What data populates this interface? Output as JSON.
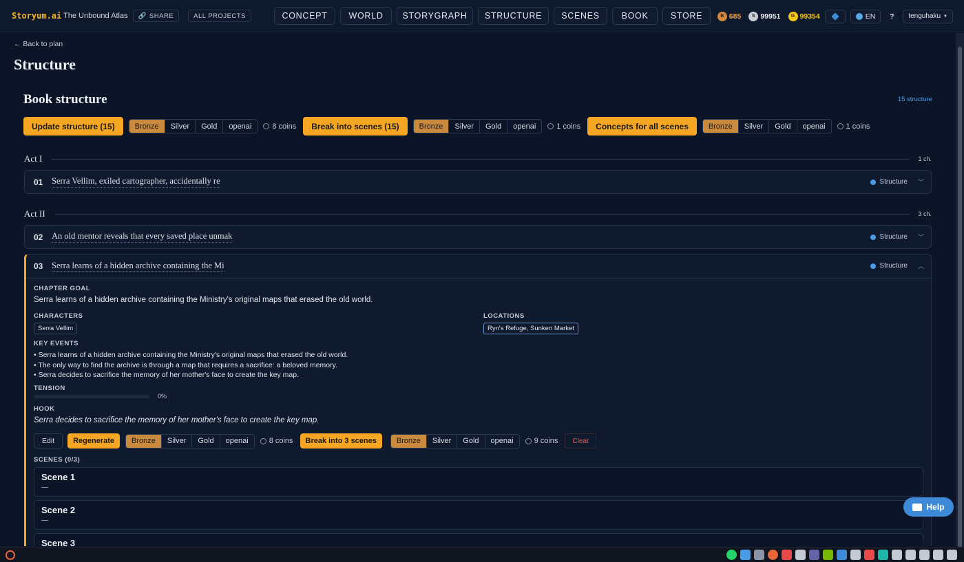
{
  "header": {
    "logo_text": "Storyum.ai",
    "project_name": "The Unbound Atlas",
    "share_label": "SHARE",
    "all_projects_label": "ALL PROJECTS",
    "nav": [
      "CONCEPT",
      "WORLD",
      "STORYGRAPH",
      "STRUCTURE",
      "SCENES",
      "BOOK",
      "STORE"
    ],
    "coins": {
      "bronze": "685",
      "silver": "99951",
      "gold": "99354"
    },
    "bronze_letter": "B",
    "silver_letter": "S",
    "gold_letter": "G",
    "lang": "EN",
    "help_glyph": "?",
    "user": "tenguhaku"
  },
  "page": {
    "back_label": "← Back to plan",
    "title": "Structure",
    "section_title": "Book structure",
    "structure_count": "15 structure"
  },
  "actions": {
    "update_label": "Update structure (15)",
    "break_label": "Break into scenes (15)",
    "concepts_label": "Concepts for all scenes",
    "tiers": [
      "Bronze",
      "Silver",
      "Gold",
      "openai"
    ],
    "cost1": "8 coins",
    "cost2": "1 coins",
    "cost3": "1 coins"
  },
  "acts": [
    {
      "label": "Act I",
      "count": "1 ch."
    },
    {
      "label": "Act II",
      "count": "3 ch."
    }
  ],
  "chapters": [
    {
      "num": "01",
      "title": "Serra Vellim, exiled cartographer, accidentally re",
      "status": "Structure"
    },
    {
      "num": "02",
      "title": "An old mentor reveals that every saved place unmak",
      "status": "Structure"
    },
    {
      "num": "03",
      "title": "Serra learns of a hidden archive containing the Mi",
      "status": "Structure"
    }
  ],
  "expanded": {
    "goal_label": "CHAPTER GOAL",
    "goal": "Serra learns of a hidden archive containing the Ministry's original maps that erased the old world.",
    "characters_label": "CHARACTERS",
    "characters": "Serra Vellim",
    "locations_label": "LOCATIONS",
    "locations": "Ryn's Refuge, Sunken Market",
    "events_label": "KEY EVENTS",
    "events": [
      "• Serra learns of a hidden archive containing the Ministry's original maps that erased the old world.",
      "• The only way to find the archive is through a map that requires a sacrifice: a beloved memory.",
      "• Serra decides to sacrifice the memory of her mother's face to create the key map."
    ],
    "tension_label": "TENSION",
    "tension_value": "0%",
    "tension_fraction": 0,
    "hook_label": "HOOK",
    "hook": "Serra decides to sacrifice the memory of her mother's face to create the key map.",
    "edit_label": "Edit",
    "regen_label": "Regenerate",
    "regen_cost": "8 coins",
    "break_label": "Break into 3 scenes",
    "break_cost": "9 coins",
    "clear_label": "Clear",
    "scenes_label": "SCENES (0/3)",
    "scenes": [
      {
        "title": "Scene 1",
        "desc": "—"
      },
      {
        "title": "Scene 2",
        "desc": "—"
      },
      {
        "title": "Scene 3",
        "desc": ""
      }
    ]
  },
  "help_label": "Help",
  "colors": {
    "accent": "#f5a623",
    "link": "#4a9be8",
    "bg": "#0c1527"
  }
}
